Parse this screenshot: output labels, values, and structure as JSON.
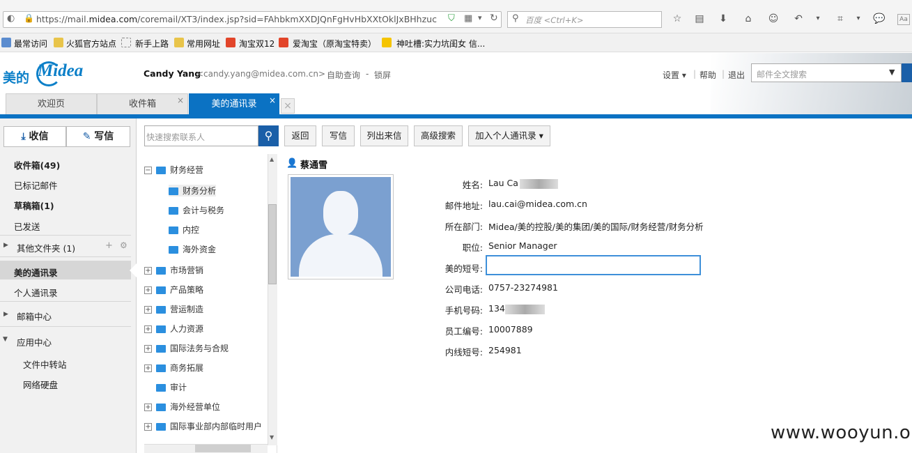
{
  "browser": {
    "url_prefix": "https://mail.",
    "url_domain": "midea.com",
    "url_rest": "/coremail/XT3/index.jsp?sid=FAhbkmXXDJQnFgHvHbXXtOklJxBHhzuc",
    "search_placeholder": "百度 <Ctrl+K>",
    "bookmarks": [
      "最常访问",
      "火狐官方站点",
      "新手上路",
      "常用网址",
      "淘宝双12",
      "爱淘宝（原淘宝特卖）",
      "神吐槽:实力坑闺女 信..."
    ]
  },
  "header": {
    "logo_cn": "美的",
    "logo_en": "Midea",
    "user_name": "Candy Yang",
    "user_email": "<candy.yang@midea.com.cn>",
    "link_query": "自助查询",
    "dash": "-",
    "link_lock": "锁屏",
    "settings": "设置 ▾",
    "help": "帮助",
    "logout": "退出",
    "fulltext_placeholder": "邮件全文搜索"
  },
  "tabs": [
    {
      "label": "欢迎页"
    },
    {
      "label": "收件箱"
    },
    {
      "label": "美的通讯录"
    }
  ],
  "sidebar": {
    "receive": "收信",
    "compose": "写信",
    "items": [
      "收件箱(49)",
      "已标记邮件",
      "草稿箱(1)",
      "已发送",
      "其他文件夹 (1)",
      "美的通讯录",
      "个人通讯录",
      "邮箱中心",
      "应用中心",
      "文件中转站",
      "网络硬盘"
    ]
  },
  "tree": {
    "search_placeholder": "快速搜索联系人",
    "nodes": [
      "财务经营",
      "财务分析",
      "会计与税务",
      "内控",
      "海外资金",
      "市场营销",
      "产品策略",
      "营运制造",
      "人力资源",
      "国际法务与合规",
      "商务拓展",
      "审计",
      "海外经营单位",
      "国际事业部内部临时用户"
    ]
  },
  "toolbar": {
    "back": "返回",
    "write": "写信",
    "list": "列出来信",
    "advanced": "高级搜索",
    "add": "加入个人通讯录 ▾"
  },
  "contact": {
    "name": "蔡通雪",
    "fields": [
      {
        "label": "姓名:",
        "value": "Lau Ca"
      },
      {
        "label": "邮件地址:",
        "value": "lau.cai@midea.com.cn"
      },
      {
        "label": "所在部门:",
        "value": "Midea/美的控股/美的集团/美的国际/财务经营/财务分析"
      },
      {
        "label": "职位:",
        "value": "Senior Manager"
      },
      {
        "label": "美的短号:",
        "value": ""
      },
      {
        "label": "公司电话:",
        "value": "0757-23274981"
      },
      {
        "label": "手机号码:",
        "value": "134"
      },
      {
        "label": "员工编号:",
        "value": "10007889"
      },
      {
        "label": "内线短号:",
        "value": "254981"
      }
    ]
  },
  "watermark": "www.wooyun.org"
}
